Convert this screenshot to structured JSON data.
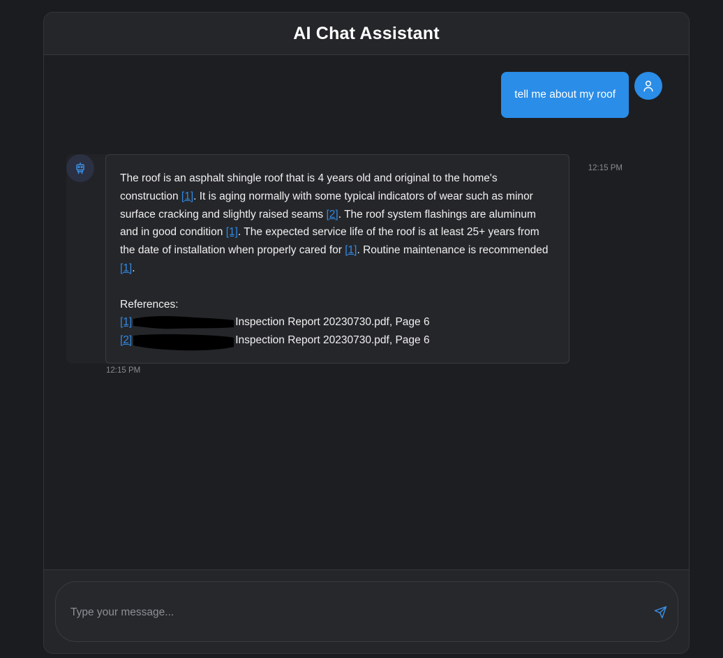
{
  "header": {
    "title": "AI Chat Assistant"
  },
  "user_message": {
    "text": "tell me about my roof",
    "time": "12:15 PM",
    "avatar_icon": "user-icon"
  },
  "bot_message": {
    "avatar_icon": "robot-icon",
    "time": "12:15 PM",
    "segments": [
      "The roof is an asphalt shingle roof that is 4 years old and original to the home's construction ",
      "[1]",
      ". It is aging normally with some typical indicators of wear such as minor surface cracking and slightly raised seams ",
      "[2]",
      ". The roof system flashings are aluminum and in good condition ",
      "[1]",
      ". The expected service life of the roof is at least 25+ years from the date of installation when properly cared for ",
      "[1]",
      ". Routine maintenance is recommended ",
      "[1]",
      "."
    ],
    "references_label": "References:",
    "references": [
      {
        "cite": "[1]",
        "text": "Inspection Report 20230730.pdf, Page 6"
      },
      {
        "cite": "[2]",
        "text": "Inspection Report 20230730.pdf, Page 6"
      }
    ]
  },
  "composer": {
    "placeholder": "Type your message...",
    "send_icon": "send-icon"
  },
  "colors": {
    "accent": "#2a8de8",
    "link": "#2f8ae6",
    "background": "#1b1c1f",
    "panel": "#25262a"
  }
}
